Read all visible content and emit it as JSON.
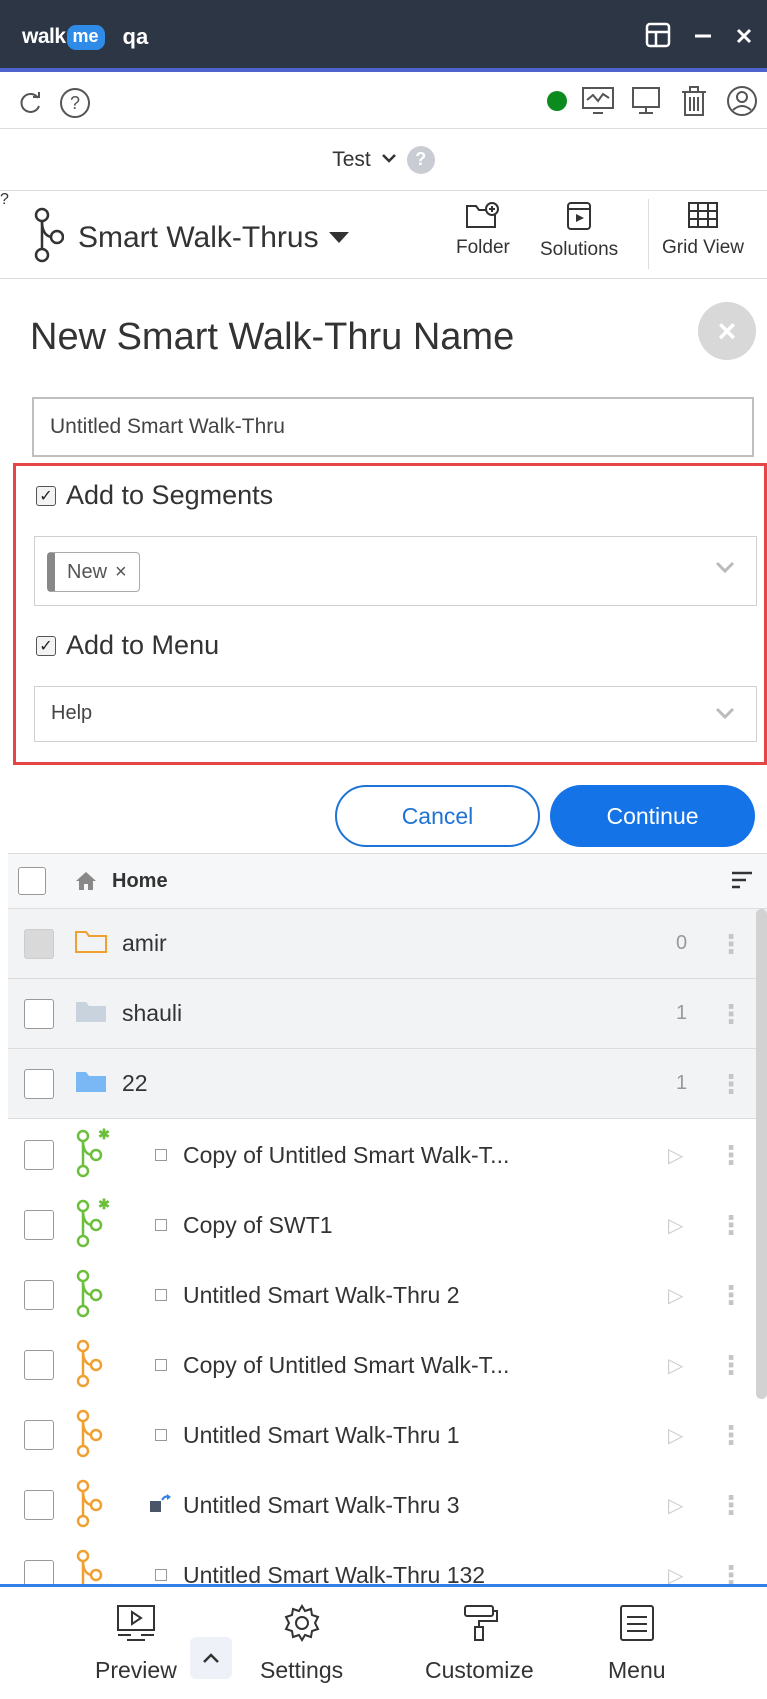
{
  "titlebar": {
    "brand_walk": "walk",
    "brand_me": "me",
    "system_name": "qa"
  },
  "env": {
    "name": "Test",
    "help": "?"
  },
  "app": {
    "title": "Smart Walk-Thrus",
    "folder_label": "Folder",
    "solutions_label": "Solutions",
    "grid_label": "Grid View"
  },
  "form": {
    "title": "New Smart Walk-Thru Name",
    "name_value": "Untitled Smart Walk-Thru",
    "segments_label": "Add to Segments",
    "segment_tag": "New",
    "menu_label": "Add to Menu",
    "menu_value": "Help",
    "cancel_label": "Cancel",
    "continue_label": "Continue"
  },
  "list": {
    "header": "Home",
    "folders": [
      {
        "name": "amir",
        "count": "0"
      },
      {
        "name": "shauli",
        "count": "1"
      },
      {
        "name": "22",
        "count": "1"
      }
    ],
    "items": [
      {
        "name": "Copy of Untitled Smart Walk-T...",
        "icon": "swt-green-new-icon"
      },
      {
        "name": "Copy of SWT1",
        "icon": "swt-green-new-icon"
      },
      {
        "name": "Untitled Smart Walk-Thru 2",
        "icon": "swt-green-icon"
      },
      {
        "name": "Copy of Untitled Smart Walk-T...",
        "icon": "swt-orange-icon"
      },
      {
        "name": "Untitled Smart Walk-Thru 1",
        "icon": "swt-orange-icon"
      },
      {
        "name": "Untitled Smart Walk-Thru 3",
        "icon": "swt-orange-icon"
      },
      {
        "name": "Untitled Smart Walk-Thru 132",
        "icon": "swt-orange-icon"
      }
    ]
  },
  "nav": {
    "preview": "Preview",
    "settings": "Settings",
    "customize": "Customize",
    "menu": "Menu"
  },
  "colors": {
    "titlebar": "#2c3645",
    "accent": "#1473e6",
    "highlight_border": "#e64545",
    "swt_green": "#6cbf3b",
    "swt_orange": "#f0a030",
    "folder_orange": "#f0a030",
    "folder_blue": "#7ab8f5"
  }
}
